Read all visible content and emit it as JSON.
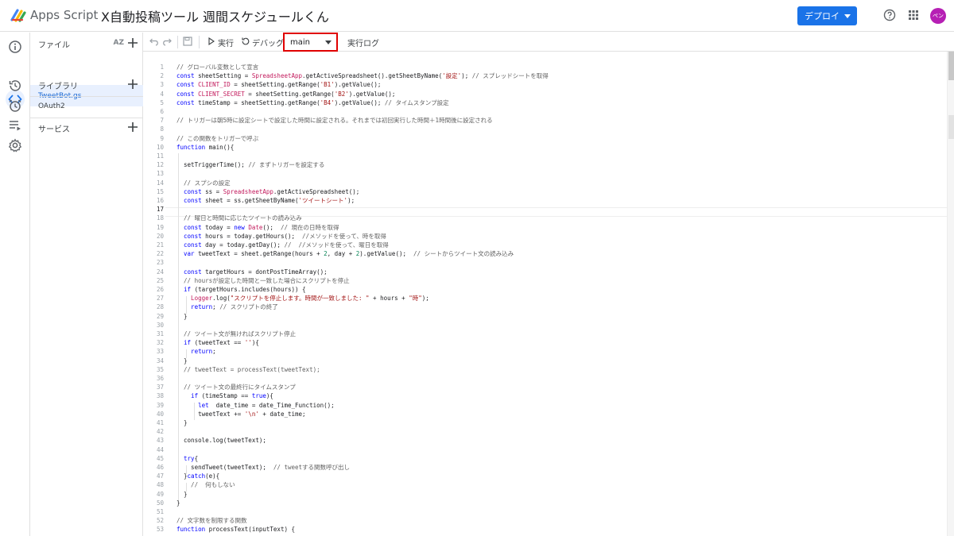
{
  "header": {
    "app_name": "Apps Script",
    "project_title": "X自動投稿ツール 週間スケジュールくん",
    "deploy_label": "デプロイ",
    "avatar_text": "ペン"
  },
  "filepanel": {
    "files_label": "ファイル",
    "sort_label": "AZ",
    "active_file": "TweetBot.gs",
    "libraries_label": "ライブラリ",
    "oauth_label": "OAuth2",
    "services_label": "サービス"
  },
  "toolbar": {
    "run_label": "実行",
    "debug_label": "デバッグ",
    "function_selected": "main",
    "log_label": "実行ログ"
  },
  "editor": {
    "current_line": 17,
    "lines": [
      [
        [
          "c",
          "// グローバル変数として宣言"
        ]
      ],
      [
        [
          "k",
          "const"
        ],
        [
          "p",
          " sheetSetting = "
        ],
        [
          "b",
          "SpreadsheetApp"
        ],
        [
          "p",
          ".getActiveSpreadsheet().getSheetByName("
        ],
        [
          "s",
          "'設定'"
        ],
        [
          "p",
          "); "
        ],
        [
          "c",
          "// スプレッドシートを取得"
        ]
      ],
      [
        [
          "k",
          "const"
        ],
        [
          "p",
          " "
        ],
        [
          "b",
          "CLIENT_ID"
        ],
        [
          "p",
          " = sheetSetting.getRange("
        ],
        [
          "s",
          "'B1'"
        ],
        [
          "p",
          ").getValue();"
        ]
      ],
      [
        [
          "k",
          "const"
        ],
        [
          "p",
          " "
        ],
        [
          "b",
          "CLIENT_SECRET"
        ],
        [
          "p",
          " = sheetSetting.getRange("
        ],
        [
          "s",
          "'B2'"
        ],
        [
          "p",
          ").getValue();"
        ]
      ],
      [
        [
          "k",
          "const"
        ],
        [
          "p",
          " timeStamp = sheetSetting.getRange("
        ],
        [
          "s",
          "'B4'"
        ],
        [
          "p",
          ").getValue(); "
        ],
        [
          "c",
          "// タイムスタンプ設定"
        ]
      ],
      [],
      [
        [
          "c",
          "// トリガーは朝5時に設定シートで設定した時間に設定される。それまでは初回実行した時間＋1時間後に設定される"
        ]
      ],
      [],
      [
        [
          "c",
          "// この関数をトリガーで呼ぶ"
        ]
      ],
      [
        [
          "k",
          "function"
        ],
        [
          "p",
          " main(){"
        ]
      ],
      [],
      [
        [
          "p",
          "  setTriggerTime(); "
        ],
        [
          "c",
          "// まずトリガーを設定する"
        ]
      ],
      [],
      [
        [
          "c",
          "  // スプシの設定"
        ]
      ],
      [
        [
          "k",
          "  const"
        ],
        [
          "p",
          " ss = "
        ],
        [
          "b",
          "SpreadsheetApp"
        ],
        [
          "p",
          ".getActiveSpreadsheet();"
        ]
      ],
      [
        [
          "k",
          "  const"
        ],
        [
          "p",
          " sheet = ss.getSheetByName("
        ],
        [
          "s",
          "'ツイートシート'"
        ],
        [
          "p",
          ");"
        ]
      ],
      [],
      [
        [
          "c",
          "  // 曜日と時間に応じたツイートの読み込み"
        ]
      ],
      [
        [
          "k",
          "  const"
        ],
        [
          "p",
          " today = "
        ],
        [
          "k",
          "new"
        ],
        [
          "p",
          " "
        ],
        [
          "b",
          "Date"
        ],
        [
          "p",
          "();  "
        ],
        [
          "c",
          "// 現在の日時を取得"
        ]
      ],
      [
        [
          "k",
          "  const"
        ],
        [
          "p",
          " hours = today.getHours();  "
        ],
        [
          "c",
          "//メソッドを使って、時を取得"
        ]
      ],
      [
        [
          "k",
          "  const"
        ],
        [
          "p",
          " day = today.getDay(); "
        ],
        [
          "c",
          "//  //メソッドを使って、曜日を取得"
        ]
      ],
      [
        [
          "k",
          "  var"
        ],
        [
          "p",
          " tweetText = sheet.getRange(hours + "
        ],
        [
          "n",
          "2"
        ],
        [
          "p",
          ", day + "
        ],
        [
          "n",
          "2"
        ],
        [
          "p",
          ").getValue();  "
        ],
        [
          "c",
          "// シートからツイート文の読み込み"
        ]
      ],
      [],
      [
        [
          "k",
          "  const"
        ],
        [
          "p",
          " targetHours = dontPostTimeArray();"
        ]
      ],
      [
        [
          "c",
          "  // hoursが設定した時間と一致した場合にスクリプトを停止"
        ]
      ],
      [
        [
          "k",
          "  if"
        ],
        [
          "p",
          " (targetHours.includes(hours)) {"
        ]
      ],
      [
        [
          "b",
          "    Logger"
        ],
        [
          "p",
          ".log("
        ],
        [
          "s",
          "\"スクリプトを停止します。時間が一致しました: \""
        ],
        [
          "p",
          " + hours + "
        ],
        [
          "s",
          "\"時\""
        ],
        [
          "p",
          ");"
        ]
      ],
      [
        [
          "k",
          "    return"
        ],
        [
          "p",
          "; "
        ],
        [
          "c",
          "// スクリプトの終了"
        ]
      ],
      [
        [
          "p",
          "  }"
        ]
      ],
      [],
      [
        [
          "c",
          "  // ツイート文が無ければスクリプト停止"
        ]
      ],
      [
        [
          "k",
          "  if"
        ],
        [
          "p",
          " (tweetText == "
        ],
        [
          "s",
          "''"
        ],
        [
          "p",
          "){"
        ]
      ],
      [
        [
          "k",
          "    return"
        ],
        [
          "p",
          ";"
        ]
      ],
      [
        [
          "p",
          "  }"
        ]
      ],
      [
        [
          "c",
          "  // tweetText = processText(tweetText);"
        ]
      ],
      [],
      [
        [
          "c",
          "  // ツイート文の最終行にタイムスタンプ"
        ]
      ],
      [
        [
          "k",
          "    if"
        ],
        [
          "p",
          " (timeStamp == "
        ],
        [
          "k",
          "true"
        ],
        [
          "p",
          "){"
        ]
      ],
      [
        [
          "k",
          "      let"
        ],
        [
          "p",
          "  date_time = date_Time_Function();"
        ]
      ],
      [
        [
          "p",
          "      tweetText += "
        ],
        [
          "s",
          "'\\n'"
        ],
        [
          "p",
          " + date_time;"
        ]
      ],
      [
        [
          "p",
          "  }"
        ]
      ],
      [],
      [
        [
          "p",
          "  console.log(tweetText);"
        ]
      ],
      [],
      [
        [
          "k",
          "  try"
        ],
        [
          "p",
          "{"
        ]
      ],
      [
        [
          "p",
          "    sendTweet(tweetText);  "
        ],
        [
          "c",
          "// tweetする関数呼び出し"
        ]
      ],
      [
        [
          "p",
          "  }"
        ],
        [
          "k",
          "catch"
        ],
        [
          "p",
          "(e){"
        ]
      ],
      [
        [
          "c",
          "    //  何もしない"
        ]
      ],
      [
        [
          "p",
          "  }"
        ]
      ],
      [
        [
          "p",
          "}"
        ]
      ],
      [],
      [
        [
          "c",
          "// 文字数を制限する関数"
        ]
      ],
      [
        [
          "k",
          "function"
        ],
        [
          "p",
          " processText(inputText) {"
        ]
      ]
    ]
  }
}
